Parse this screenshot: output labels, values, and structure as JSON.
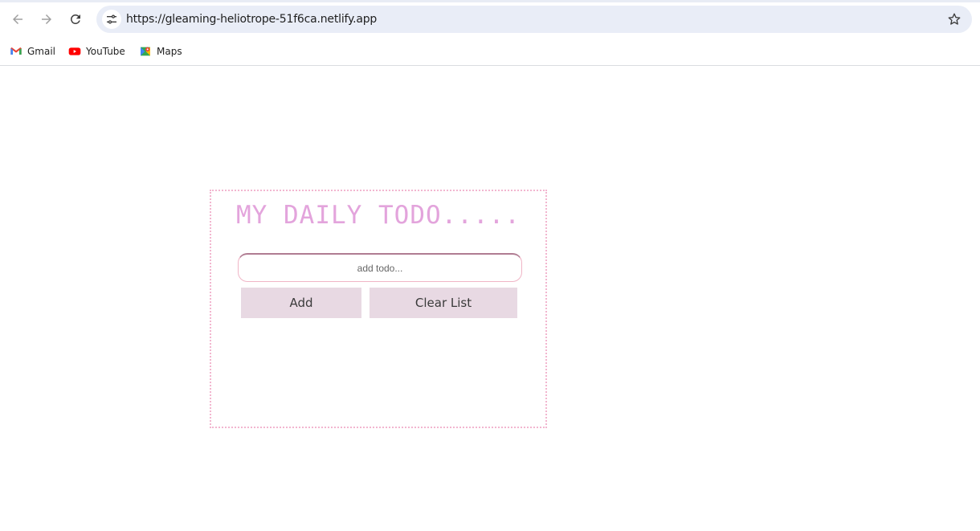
{
  "browser": {
    "url": "https://gleaming-heliotrope-51f6ca.netlify.app",
    "back_icon": "arrow-left-icon",
    "forward_icon": "arrow-right-icon",
    "reload_icon": "reload-icon",
    "site_info_icon": "tune-icon",
    "bookmark_star_icon": "star-icon"
  },
  "bookmarks": [
    {
      "label": "Gmail",
      "icon": "gmail-icon"
    },
    {
      "label": "YouTube",
      "icon": "youtube-icon"
    },
    {
      "label": "Maps",
      "icon": "maps-icon"
    }
  ],
  "app": {
    "title": "MY DAILY TODO.....",
    "input": {
      "placeholder": "add todo...",
      "value": ""
    },
    "add_label": "Add",
    "clear_label": "Clear List",
    "colors": {
      "title": "#e3a4dc",
      "button_bg": "#e8d9e3",
      "border": "#f2b6cf"
    }
  }
}
